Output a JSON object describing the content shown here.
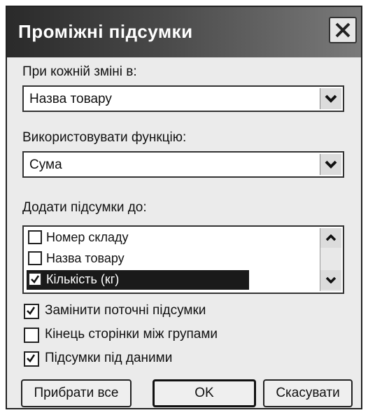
{
  "window": {
    "title": "Проміжні підсумки"
  },
  "group_by": {
    "label": "При кожній зміні в:",
    "value": "Назва товару"
  },
  "function": {
    "label": "Використовувати функцію:",
    "value": "Сума"
  },
  "add_subtotals": {
    "label": "Додати підсумки до:",
    "items": [
      {
        "label": "Номер складу",
        "checked": false,
        "selected": false
      },
      {
        "label": "Назва товару",
        "checked": false,
        "selected": false
      },
      {
        "label": "Кількість (кг)",
        "checked": true,
        "selected": true
      }
    ]
  },
  "options": {
    "replace_current": {
      "label": "Замінити поточні підсумки",
      "checked": true
    },
    "page_break": {
      "label": "Кінець сторінки між групами",
      "checked": false
    },
    "summary_below": {
      "label": "Підсумки під даними",
      "checked": true
    }
  },
  "buttons": {
    "remove_all": "Прибрати все",
    "ok": "OK",
    "cancel": "Скасувати"
  },
  "icons": {
    "close": "close-icon",
    "dropdown": "chevron-down-icon",
    "scroll_up": "chevron-up-icon",
    "check": "checkmark-icon"
  }
}
